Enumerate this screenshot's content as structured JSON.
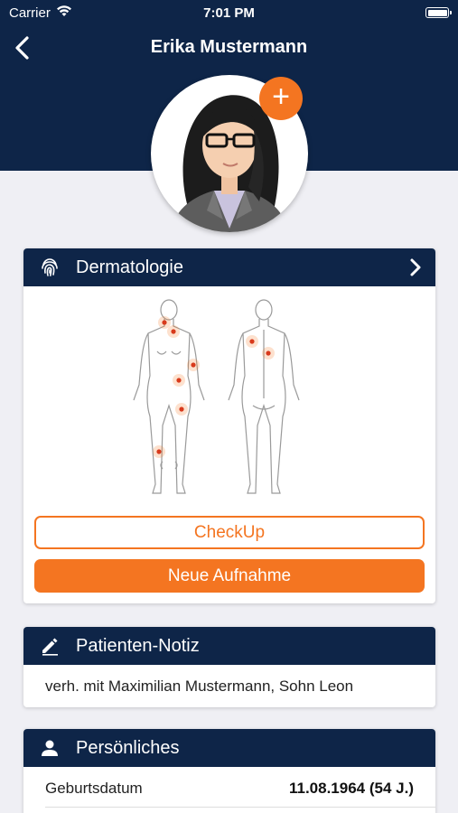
{
  "status_bar": {
    "carrier": "Carrier",
    "time": "7:01 PM"
  },
  "nav": {
    "title": "Erika Mustermann",
    "back_icon": "chevron-left-icon"
  },
  "avatar": {
    "add_label": "+"
  },
  "colors": {
    "navy": "#0e2548",
    "accent": "#f47521",
    "background": "#efeff4"
  },
  "dermatology": {
    "title": "Dermatologie",
    "icon": "fingerprint-icon",
    "checkup_label": "CheckUp",
    "new_recording_label": "Neue Aufnahme"
  },
  "patient_note": {
    "title": "Patienten-Notiz",
    "icon": "pencil-icon",
    "text": "verh. mit Maximilian Mustermann, Sohn Leon"
  },
  "personal": {
    "title": "Persönliches",
    "icon": "person-icon",
    "rows": [
      {
        "label": "Geburtsdatum",
        "value": "11.08.1964 (54 J.)"
      }
    ]
  }
}
